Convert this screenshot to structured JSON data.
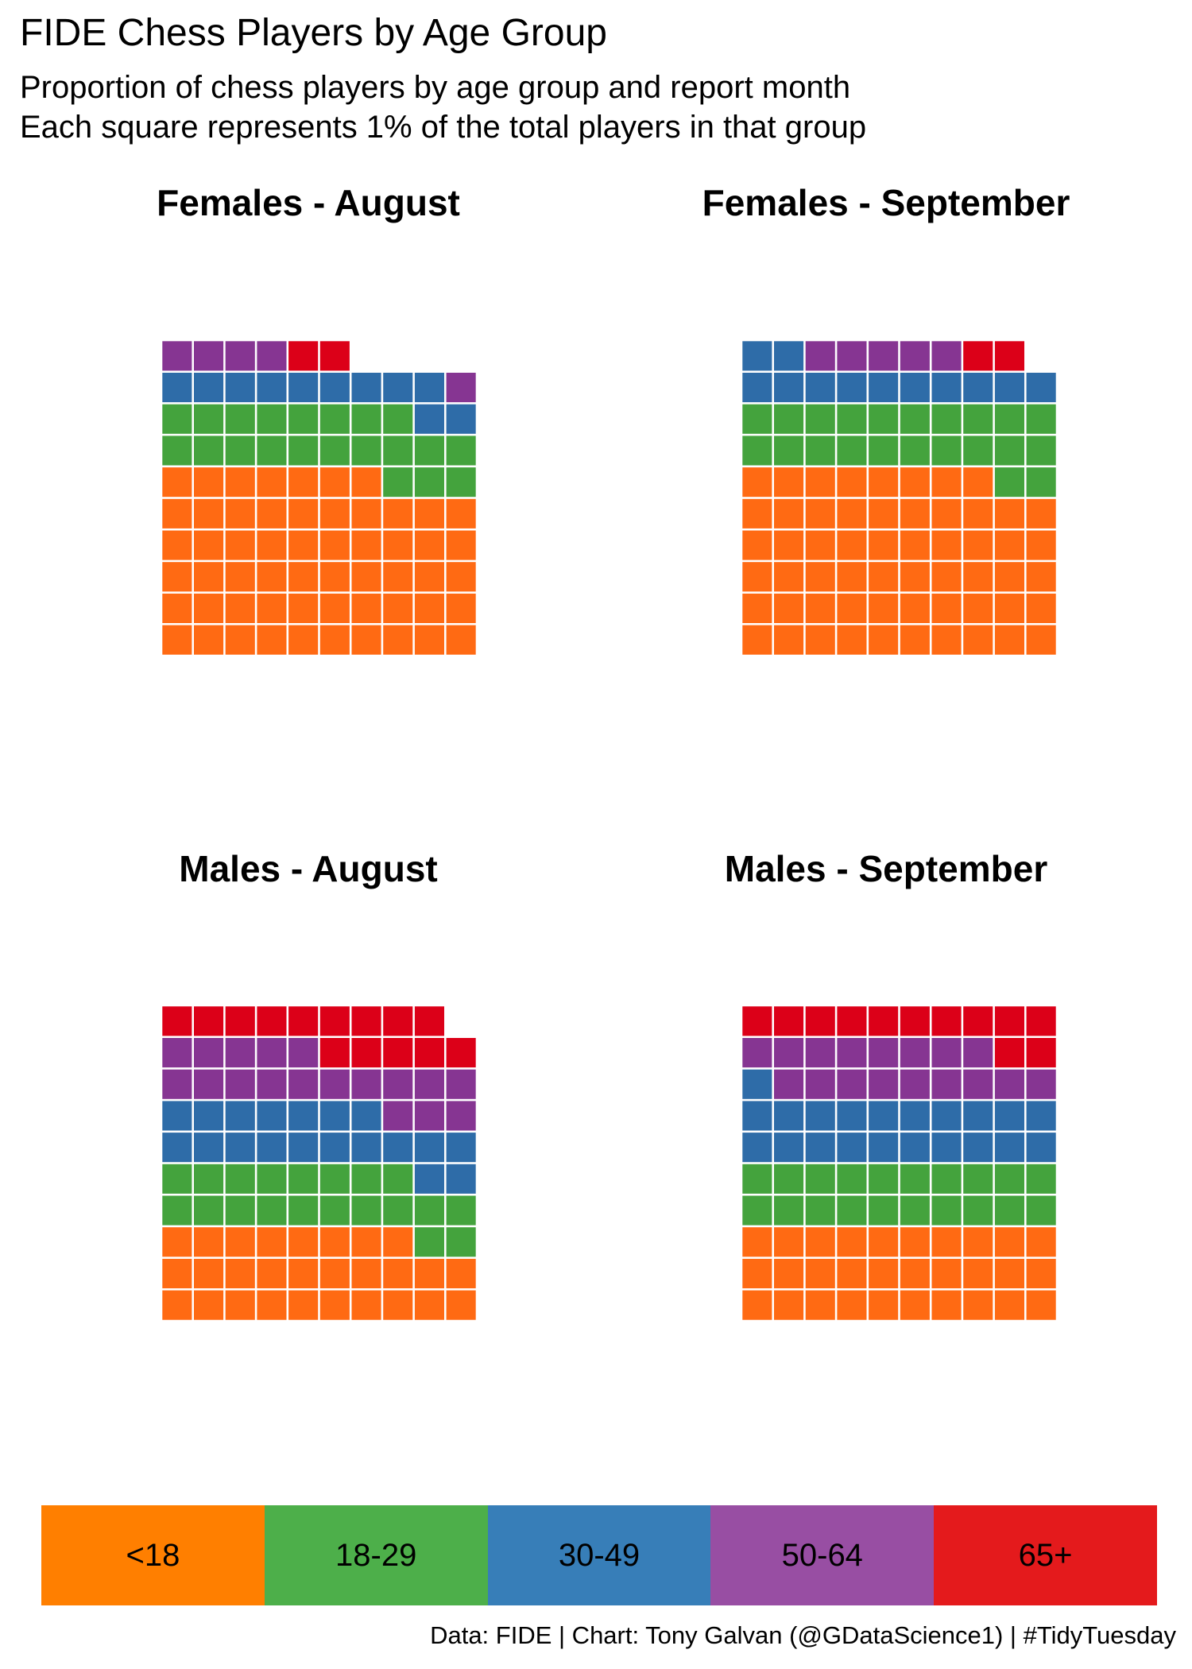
{
  "title": "FIDE Chess Players by Age Group",
  "subtitle_lines": [
    "Proportion of chess players by age group and report month",
    "Each square represents 1% of the total players in that group"
  ],
  "caption": "Data: FIDE | Chart: Tony Galvan (@GDataScience1) | #TidyTuesday",
  "chart_data": {
    "type": "waffle",
    "unit": "1%",
    "legend": {
      "position": "bottom",
      "entries": [
        {
          "label": "<18",
          "color": "#ff7f00"
        },
        {
          "label": "18-29",
          "color": "#4daf4a"
        },
        {
          "label": "30-49",
          "color": "#377eb8"
        },
        {
          "label": "50-64",
          "color": "#984ea3"
        },
        {
          "label": "65+",
          "color": "#e41a1c"
        }
      ]
    },
    "square_colors": {
      "<18": "#ff6a13",
      "18-29": "#44a33d",
      "30-49": "#2e6ca8",
      "50-64": "#863592",
      "65+": "#dc0018"
    },
    "panels": [
      {
        "title": "Females - August",
        "values": {
          "<18": 57,
          "18-29": 21,
          "30-49": 11,
          "50-64": 5,
          "65+": 2
        }
      },
      {
        "title": "Females - September",
        "values": {
          "<18": 58,
          "18-29": 22,
          "30-49": 12,
          "50-64": 5,
          "65+": 2
        }
      },
      {
        "title": "Males - August",
        "values": {
          "<18": 28,
          "18-29": 20,
          "30-49": 19,
          "50-64": 18,
          "65+": 14
        }
      },
      {
        "title": "Males - September",
        "values": {
          "<18": 30,
          "18-29": 20,
          "30-49": 21,
          "50-64": 17,
          "65+": 12
        }
      }
    ]
  }
}
